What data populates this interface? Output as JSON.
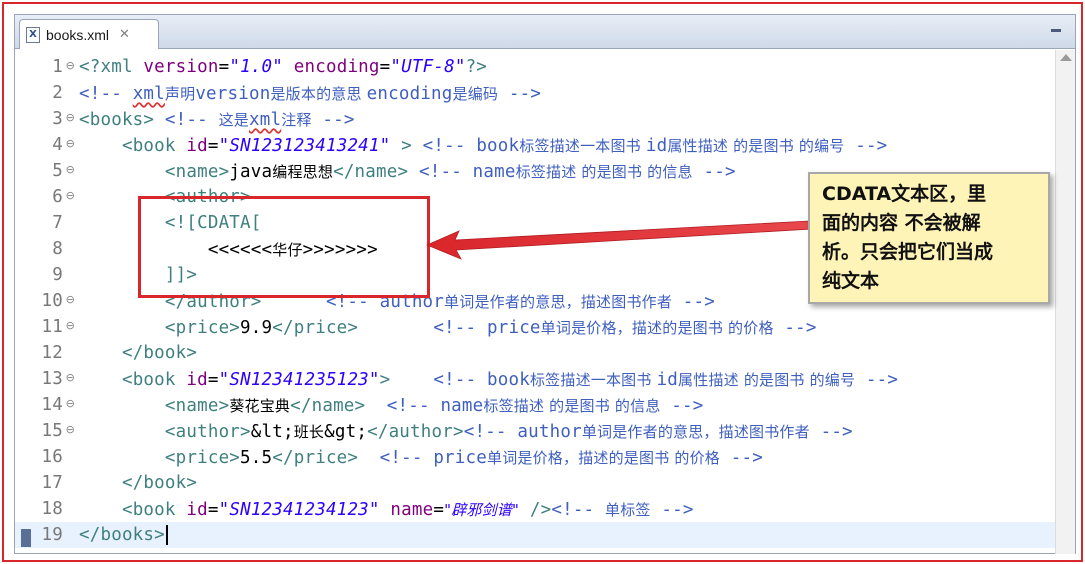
{
  "tab": {
    "label": "books.xml",
    "close": "✕",
    "file_icon": "X"
  },
  "lines": [
    {
      "n": "1",
      "fold": "⊖",
      "parts": [
        [
          "tg",
          "<?xml "
        ],
        [
          "at",
          "version"
        ],
        [
          "tx",
          "="
        ],
        [
          "av",
          "\"1.0\""
        ],
        [
          "tx",
          " "
        ],
        [
          "at",
          "encoding"
        ],
        [
          "tx",
          "="
        ],
        [
          "av",
          "\"UTF-8\""
        ],
        [
          "tg",
          "?>"
        ]
      ]
    },
    {
      "n": "2",
      "fold": "",
      "parts": [
        [
          "cm",
          "<!-- "
        ],
        [
          "cm sq",
          "xml"
        ],
        [
          "cm cj",
          "声明"
        ],
        [
          "cm",
          "version"
        ],
        [
          "cm cj",
          "是版本的意思 "
        ],
        [
          "cm",
          "encoding"
        ],
        [
          "cm cj",
          "是编码"
        ],
        [
          "cm",
          " -->"
        ]
      ]
    },
    {
      "n": "3",
      "fold": "⊖",
      "parts": [
        [
          "tg",
          "<books>"
        ],
        [
          "tx",
          " "
        ],
        [
          "cm",
          "<!-- "
        ],
        [
          "cm cj",
          "这是"
        ],
        [
          "cm sq",
          "xml"
        ],
        [
          "cm cj",
          "注释"
        ],
        [
          "cm",
          " -->"
        ]
      ]
    },
    {
      "n": "4",
      "fold": "⊖",
      "parts": [
        [
          "tx",
          "    "
        ],
        [
          "tg",
          "<book "
        ],
        [
          "at",
          "id"
        ],
        [
          "tx",
          "="
        ],
        [
          "av",
          "\"SN123123413241\""
        ],
        [
          "tx",
          " "
        ],
        [
          "tg",
          ">"
        ],
        [
          "tx",
          " "
        ],
        [
          "cm",
          "<!-- book"
        ],
        [
          "cm cj",
          "标签描述一本图书 "
        ],
        [
          "cm",
          "id"
        ],
        [
          "cm cj",
          "属性描述 的是图书 的编号"
        ],
        [
          "cm",
          " -->"
        ]
      ]
    },
    {
      "n": "5",
      "fold": "⊖",
      "parts": [
        [
          "tx",
          "        "
        ],
        [
          "tg",
          "<name>"
        ],
        [
          "tx",
          "java"
        ],
        [
          "tx cj",
          "编程思想"
        ],
        [
          "tg",
          "</name>"
        ],
        [
          "tx",
          " "
        ],
        [
          "cm",
          "<!-- name"
        ],
        [
          "cm cj",
          "标签描述 的是图书 的信息"
        ],
        [
          "cm",
          " -->"
        ]
      ]
    },
    {
      "n": "6",
      "fold": "⊖",
      "parts": [
        [
          "tx",
          "        "
        ],
        [
          "tg",
          "<author>"
        ]
      ]
    },
    {
      "n": "7",
      "fold": "",
      "parts": [
        [
          "tx",
          "        "
        ],
        [
          "cd",
          "<![CDATA["
        ]
      ]
    },
    {
      "n": "8",
      "fold": "",
      "parts": [
        [
          "tx",
          "            "
        ],
        [
          "tx",
          "<<<<<<"
        ],
        [
          "tx cj",
          "华仔"
        ],
        [
          "tx",
          ">>>>>>>"
        ]
      ]
    },
    {
      "n": "9",
      "fold": "",
      "parts": [
        [
          "tx",
          "        "
        ],
        [
          "cd",
          "]]>"
        ]
      ]
    },
    {
      "n": "10",
      "fold": "⊖",
      "parts": [
        [
          "tx",
          "        "
        ],
        [
          "tg",
          "</author>"
        ],
        [
          "tx",
          "      "
        ],
        [
          "cm",
          "<!-- author"
        ],
        [
          "cm cj",
          "单词是作者的意思，描述图书作者"
        ],
        [
          "cm",
          " -->"
        ]
      ]
    },
    {
      "n": "11",
      "fold": "⊖",
      "parts": [
        [
          "tx",
          "        "
        ],
        [
          "tg",
          "<price>"
        ],
        [
          "tx",
          "9.9"
        ],
        [
          "tg",
          "</price>"
        ],
        [
          "tx",
          "       "
        ],
        [
          "cm",
          "<!-- price"
        ],
        [
          "cm cj",
          "单词是价格，描述的是图书 的价格"
        ],
        [
          "cm",
          " -->"
        ]
      ]
    },
    {
      "n": "12",
      "fold": "",
      "parts": [
        [
          "tx",
          "    "
        ],
        [
          "tg",
          "</book>"
        ]
      ]
    },
    {
      "n": "13",
      "fold": "⊖",
      "parts": [
        [
          "tx",
          "    "
        ],
        [
          "tg",
          "<book "
        ],
        [
          "at",
          "id"
        ],
        [
          "tx",
          "="
        ],
        [
          "av",
          "\"SN12341235123\""
        ],
        [
          "tg",
          ">"
        ],
        [
          "tx",
          "    "
        ],
        [
          "cm",
          "<!-- book"
        ],
        [
          "cm cj",
          "标签描述一本图书 "
        ],
        [
          "cm",
          "id"
        ],
        [
          "cm cj",
          "属性描述 的是图书 的编号"
        ],
        [
          "cm",
          " -->"
        ]
      ]
    },
    {
      "n": "14",
      "fold": "⊖",
      "parts": [
        [
          "tx",
          "        "
        ],
        [
          "tg",
          "<name>"
        ],
        [
          "tx cj",
          "葵花宝典"
        ],
        [
          "tg",
          "</name>"
        ],
        [
          "tx",
          "  "
        ],
        [
          "cm",
          "<!-- name"
        ],
        [
          "cm cj",
          "标签描述 的是图书 的信息"
        ],
        [
          "cm",
          " -->"
        ]
      ]
    },
    {
      "n": "15",
      "fold": "⊖",
      "parts": [
        [
          "tx",
          "        "
        ],
        [
          "tg",
          "<author>"
        ],
        [
          "tx",
          "&lt;"
        ],
        [
          "tx cj",
          "班长"
        ],
        [
          "tx",
          "&gt;"
        ],
        [
          "tg",
          "</author>"
        ],
        [
          "cm",
          "<!-- author"
        ],
        [
          "cm cj",
          "单词是作者的意思，描述图书作者"
        ],
        [
          "cm",
          " -->"
        ]
      ]
    },
    {
      "n": "16",
      "fold": "",
      "parts": [
        [
          "tx",
          "        "
        ],
        [
          "tg",
          "<price>"
        ],
        [
          "tx",
          "5.5"
        ],
        [
          "tg",
          "</price>"
        ],
        [
          "tx",
          "  "
        ],
        [
          "cm",
          "<!-- price"
        ],
        [
          "cm cj",
          "单词是价格，描述的是图书 的价格"
        ],
        [
          "cm",
          " -->"
        ]
      ]
    },
    {
      "n": "17",
      "fold": "",
      "parts": [
        [
          "tx",
          "    "
        ],
        [
          "tg",
          "</book>"
        ]
      ]
    },
    {
      "n": "18",
      "fold": "",
      "parts": [
        [
          "tx",
          "    "
        ],
        [
          "tg",
          "<book "
        ],
        [
          "at",
          "id"
        ],
        [
          "tx",
          "="
        ],
        [
          "av",
          "\"SN12341234123\""
        ],
        [
          "tx",
          " "
        ],
        [
          "at",
          "name"
        ],
        [
          "tx",
          "="
        ],
        [
          "av cj",
          "\"辟邪剑谱\""
        ],
        [
          "tx",
          " "
        ],
        [
          "tg",
          "/>"
        ],
        [
          "cm",
          "<!-- "
        ],
        [
          "cm cj",
          "单标签"
        ],
        [
          "cm",
          " -->"
        ]
      ]
    },
    {
      "n": "19",
      "fold": "",
      "parts": [
        [
          "tg",
          "</books>"
        ]
      ]
    }
  ],
  "callout": {
    "lines": [
      "CDATA文本区，里",
      "面的内容 不会被解",
      "析。只会把它们当成",
      "纯文本"
    ]
  },
  "colors": {
    "annotation_red": "#d9262b",
    "callout_bg": "#fff4b8",
    "current_line": "#e8f2fe"
  }
}
